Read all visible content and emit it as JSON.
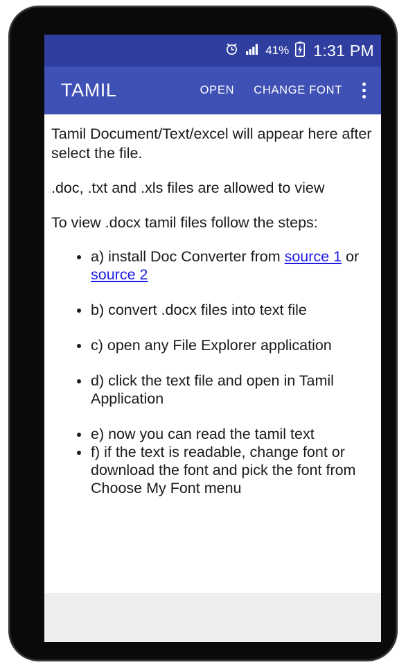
{
  "status_bar": {
    "alarm_icon": "alarm-clock-icon",
    "signal_icon": "cellular-signal-icon",
    "battery_percent": "41%",
    "battery_icon": "battery-charging-icon",
    "time": "1:31 PM",
    "background_color": "#303f9f"
  },
  "app_bar": {
    "title": "TAMIL",
    "open_label": "OPEN",
    "change_font_label": "CHANGE FONT",
    "overflow_icon": "more-vertical-icon",
    "background_color": "#3f51b5"
  },
  "content": {
    "paragraphs": [
      "Tamil Document/Text/excel will appear here after select the file.",
      ".doc, .txt and .xls files are allowed to view",
      "To view .docx tamil files follow the steps:"
    ],
    "steps": [
      {
        "prefix": "a) install Doc Converter from ",
        "link1": "source 1",
        "middle": " or ",
        "link2": "source 2",
        "suffix": ""
      },
      {
        "text": "b) convert .docx files into text file"
      },
      {
        "text": "c) open any File Explorer application"
      },
      {
        "text": "d) click the text file and open in Tamil Application"
      },
      {
        "text": "e) now you can read the tamil text"
      },
      {
        "text": "f) if the text is readable, change font or download the font and pick the font from Choose My Font menu"
      }
    ],
    "link_color": "#1a1ae8",
    "text_color": "#1a1a1a"
  },
  "bottom_banner": {
    "background_color": "#eeeeee"
  }
}
